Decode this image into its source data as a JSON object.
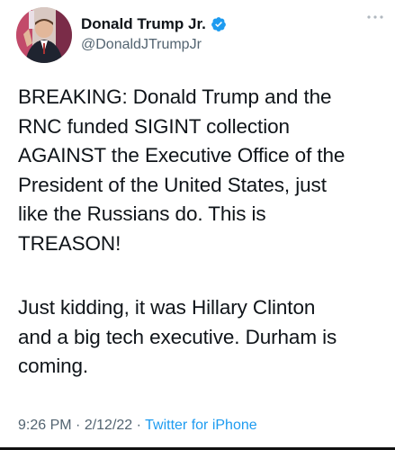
{
  "author": {
    "display_name": "Donald Trump Jr.",
    "handle": "@DonaldJTrumpJr",
    "verified": true
  },
  "tweet": {
    "paragraph1_lines": [
      "BREAKING: Donald Trump and the",
      "RNC funded SIGINT collection",
      "AGAINST the Executive Office of the",
      "President of the United States, just",
      "like the Russians do. This is",
      "TREASON!"
    ],
    "paragraph2_lines": [
      "Just kidding, it was Hillary Clinton",
      "and a big tech executive. Durham is",
      "coming."
    ]
  },
  "meta": {
    "time": "9:26 PM",
    "sep1": " · ",
    "date": "2/12/22",
    "sep2": " · ",
    "source": "Twitter for iPhone"
  },
  "colors": {
    "text": "#0f1419",
    "secondary": "#536471",
    "accent": "#1d9bf0"
  },
  "icons": {
    "verified": "verified-badge-icon",
    "more": "more-options-icon"
  }
}
